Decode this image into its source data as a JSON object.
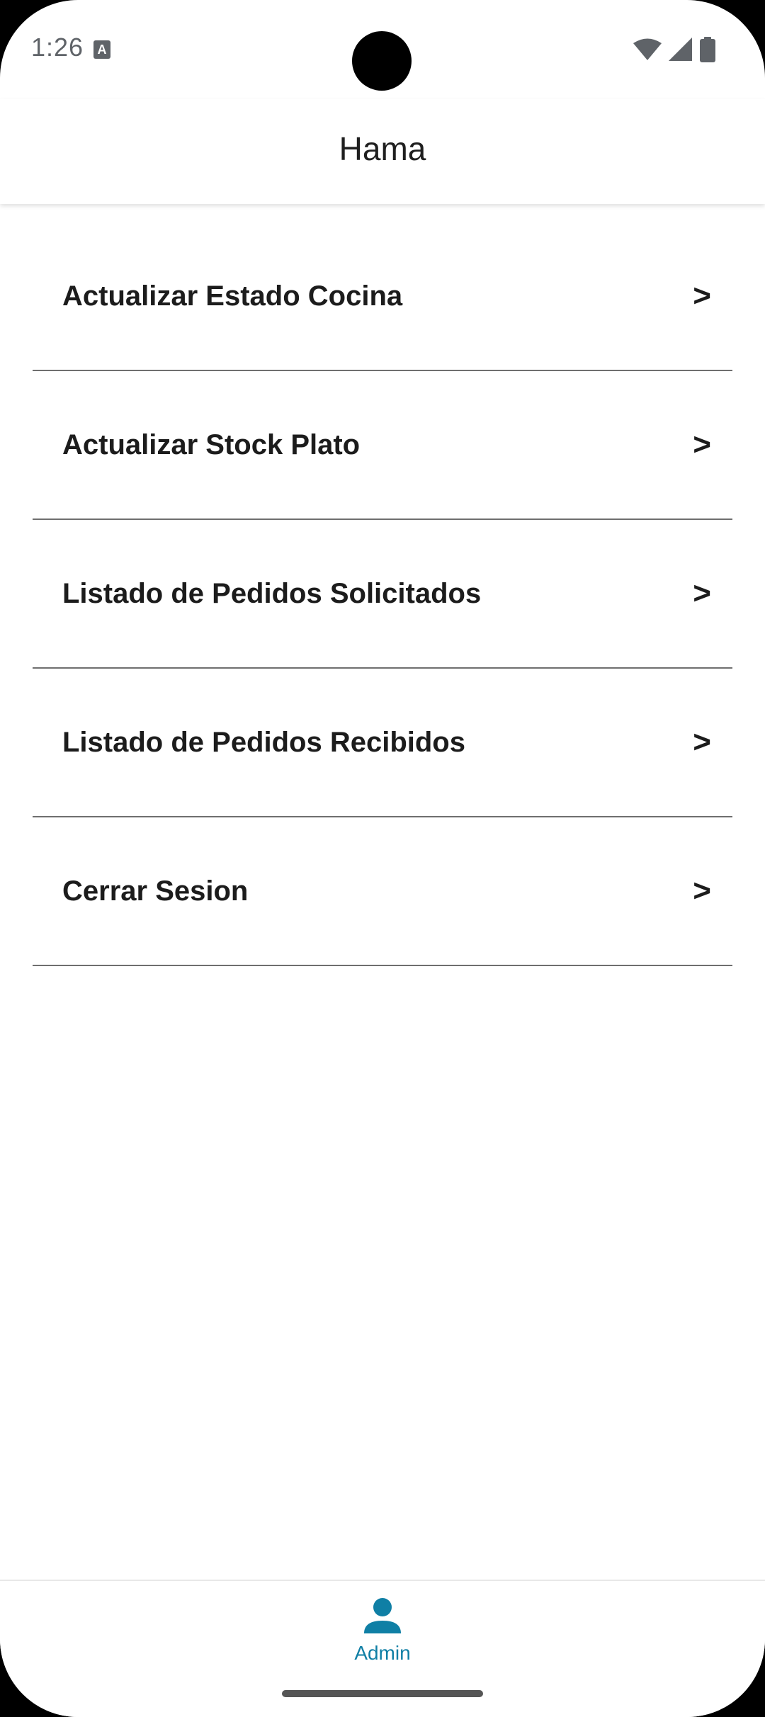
{
  "status_bar": {
    "time": "1:26",
    "notification_icon": "A"
  },
  "app_bar": {
    "title": "Hama"
  },
  "menu": {
    "items": [
      {
        "label": "Actualizar Estado Cocina",
        "chevron": ">"
      },
      {
        "label": "Actualizar Stock Plato",
        "chevron": ">"
      },
      {
        "label": "Listado de Pedidos Solicitados",
        "chevron": ">"
      },
      {
        "label": "Listado de Pedidos Recibidos",
        "chevron": ">"
      },
      {
        "label": "Cerrar Sesion",
        "chevron": ">"
      }
    ]
  },
  "bottom_nav": {
    "items": [
      {
        "label": "Admin",
        "icon": "person-icon",
        "active": true
      }
    ]
  },
  "colors": {
    "accent": "#0f7fa5",
    "divider": "#6f6f6f",
    "text": "#1c1c1c",
    "status_text": "#5f6368"
  }
}
